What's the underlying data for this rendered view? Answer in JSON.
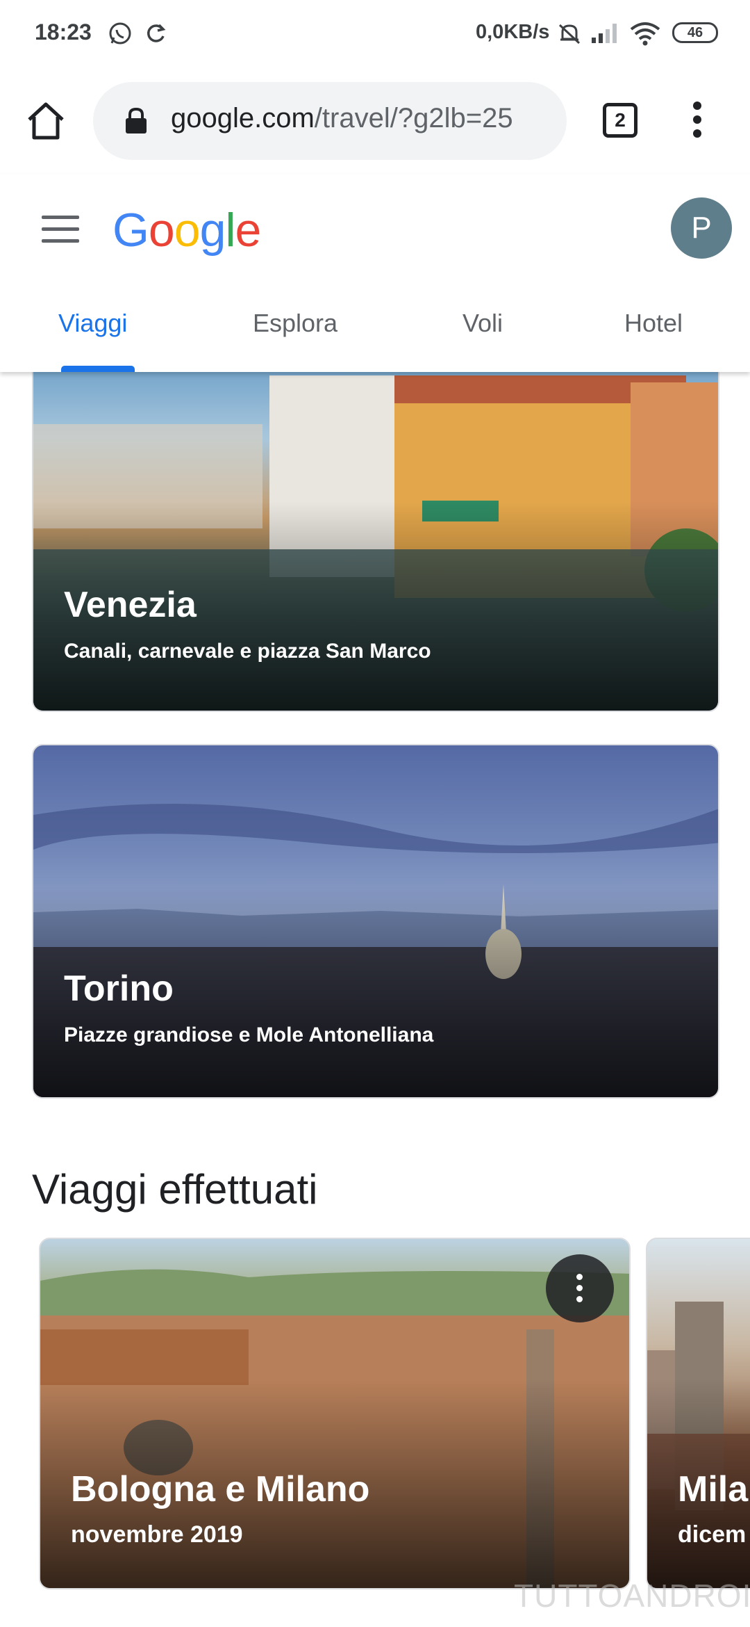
{
  "status_bar": {
    "time": "18:23",
    "speed": "0,0KB/s",
    "battery": "46"
  },
  "browser": {
    "url_domain": "google.com",
    "url_path": "/travel/?g2lb=25",
    "tab_count": "2"
  },
  "header": {
    "logo_letters": [
      "G",
      "o",
      "o",
      "g",
      "l",
      "e"
    ],
    "logo_colors": [
      "#4285F4",
      "#EA4335",
      "#FBBC05",
      "#4285F4",
      "#34A853",
      "#EA4335"
    ],
    "avatar_letter": "P",
    "tabs": [
      {
        "label": "Viaggi",
        "active": true
      },
      {
        "label": "Esplora",
        "active": false
      },
      {
        "label": "Voli",
        "active": false
      },
      {
        "label": "Hotel",
        "active": false
      }
    ]
  },
  "destinations": [
    {
      "title": "Venezia",
      "subtitle": "Canali, carnevale e piazza San Marco"
    },
    {
      "title": "Torino",
      "subtitle": "Piazze grandiose e Mole Antonelliana"
    }
  ],
  "past_trips": {
    "section_title": "Viaggi effettuati",
    "items": [
      {
        "title": "Bologna e Milano",
        "date": "novembre 2019"
      },
      {
        "title": "Mila",
        "date": "dicem"
      }
    ]
  },
  "watermark": "TUTTOANDROID"
}
